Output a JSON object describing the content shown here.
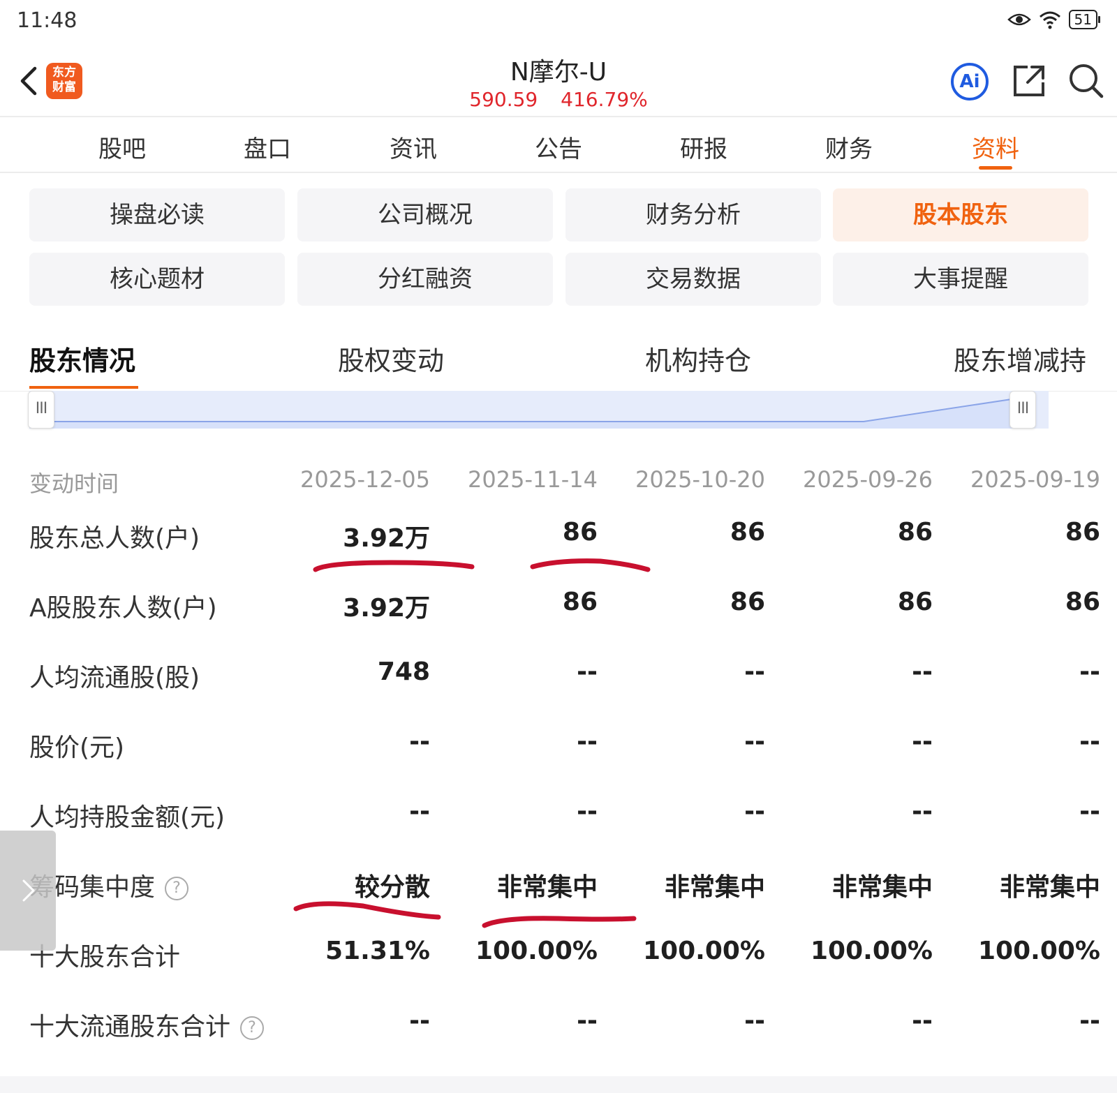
{
  "status_bar": {
    "time": "11:48",
    "battery": "51"
  },
  "header": {
    "logo_text_line1": "东方",
    "logo_text_line2": "财富",
    "title": "N摩尔-U",
    "price": "590.59",
    "change_pct": "416.79%",
    "ai_label": "Ai"
  },
  "nav_tabs": [
    {
      "label": "股吧",
      "active": false
    },
    {
      "label": "盘口",
      "active": false
    },
    {
      "label": "资讯",
      "active": false
    },
    {
      "label": "公告",
      "active": false
    },
    {
      "label": "研报",
      "active": false
    },
    {
      "label": "财务",
      "active": false
    },
    {
      "label": "资料",
      "active": true
    }
  ],
  "grid_buttons": [
    {
      "label": "操盘必读",
      "active": false
    },
    {
      "label": "公司概况",
      "active": false
    },
    {
      "label": "财务分析",
      "active": false
    },
    {
      "label": "股本股东",
      "active": true
    },
    {
      "label": "核心题材",
      "active": false
    },
    {
      "label": "分红融资",
      "active": false
    },
    {
      "label": "交易数据",
      "active": false
    },
    {
      "label": "大事提醒",
      "active": false
    }
  ],
  "sub_tabs": [
    {
      "label": "股东情况",
      "active": true
    },
    {
      "label": "股权变动",
      "active": false
    },
    {
      "label": "机构持仓",
      "active": false
    },
    {
      "label": "股东增减持",
      "active": false
    }
  ],
  "slider_handle_glyph": "III",
  "table": {
    "header_label": "变动时间",
    "dates": [
      "2025-12-05",
      "2025-11-14",
      "2025-10-20",
      "2025-09-26",
      "2025-09-19"
    ],
    "rows": [
      {
        "label": "股东总人数(户)",
        "values": [
          "3.92万",
          "86",
          "86",
          "86",
          "86"
        ],
        "help": false
      },
      {
        "label": "A股股东人数(户)",
        "values": [
          "3.92万",
          "86",
          "86",
          "86",
          "86"
        ],
        "help": false
      },
      {
        "label": "人均流通股(股)",
        "values": [
          "748",
          "--",
          "--",
          "--",
          "--"
        ],
        "help": false
      },
      {
        "label": "股价(元)",
        "values": [
          "--",
          "--",
          "--",
          "--",
          "--"
        ],
        "help": false
      },
      {
        "label": "人均持股金额(元)",
        "values": [
          "--",
          "--",
          "--",
          "--",
          "--"
        ],
        "help": false
      },
      {
        "label": "筹码集中度",
        "values": [
          "较分散",
          "非常集中",
          "非常集中",
          "非常集中",
          "非常集中"
        ],
        "help": true
      },
      {
        "label": "十大股东合计",
        "values": [
          "51.31%",
          "100.00%",
          "100.00%",
          "100.00%",
          "100.00%"
        ],
        "help": false
      },
      {
        "label": "十大流通股东合计",
        "values": [
          "--",
          "--",
          "--",
          "--",
          "--"
        ],
        "help": true
      }
    ]
  },
  "colors": {
    "accent": "#f0620f",
    "price_red": "#e0262c",
    "ai_blue": "#1f5be0",
    "annotation_red": "#c8102e"
  }
}
